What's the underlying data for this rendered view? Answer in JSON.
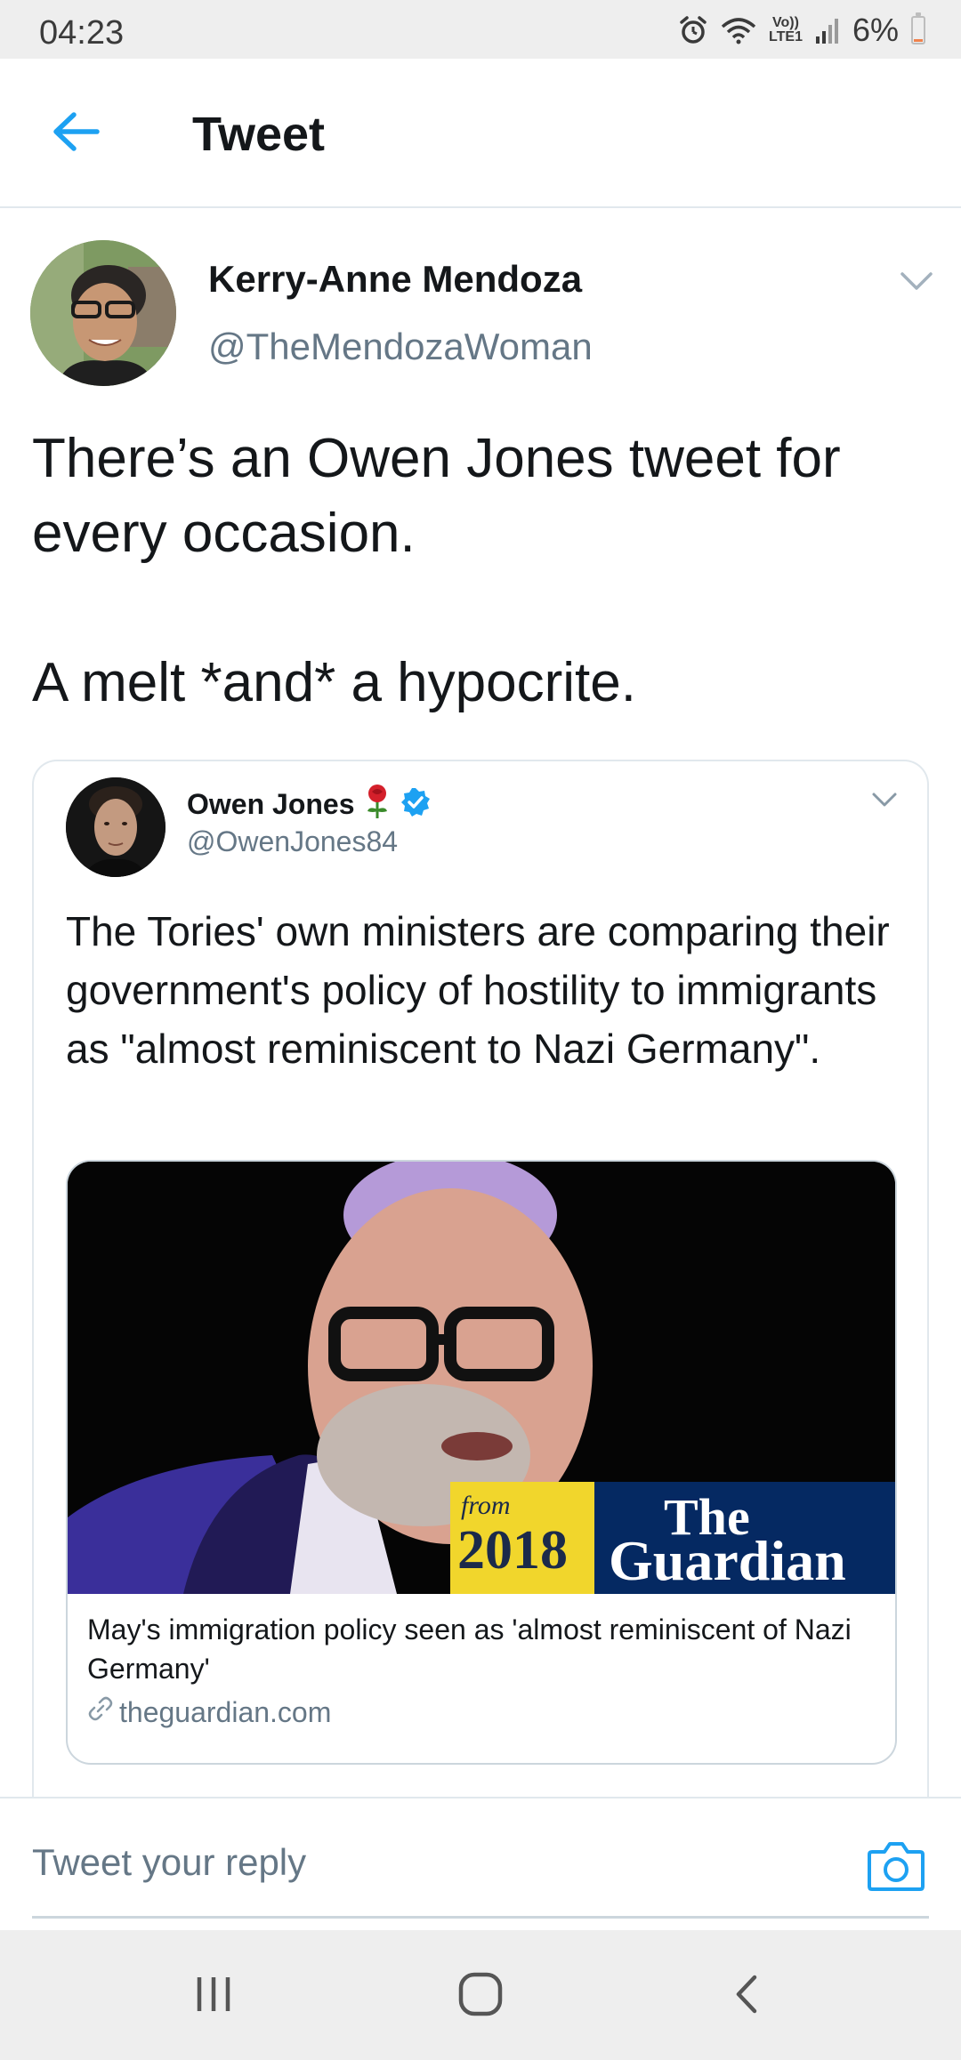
{
  "status_bar": {
    "time": "04:23",
    "icons": [
      "alarm-icon",
      "wifi-icon",
      "volte-lte-icon",
      "signal-icon",
      "battery-icon"
    ],
    "lte_label_top": "Vo))",
    "lte_label_bottom": "LTE1",
    "battery_percent": "6%",
    "battery_level": 0.06
  },
  "header": {
    "back_icon": "arrow-left-icon",
    "title": "Tweet",
    "accent_color": "#1da1f2"
  },
  "tweet": {
    "author_name": "Kerry-Anne Mendoza",
    "author_handle": "@TheMendozaWoman",
    "menu_icon": "chevron-down-icon",
    "text": "There’s an Owen Jones tweet for every occasion.\n\nA melt *and* a hypocrite."
  },
  "quoted_tweet": {
    "author_name": "Owen Jones",
    "rose_icon": "rose-icon",
    "verified_icon": "verified-badge-icon",
    "author_handle": "@OwenJones84",
    "text": "The Tories' own ministers are comparing their government's policy of hostility to immigrants as \"almost reminiscent to Nazi Germany\".",
    "card": {
      "badge_from": "from",
      "badge_year": "2018",
      "brand_line1": "The",
      "brand_line2": "Guardian",
      "title": "May's immigration policy seen as 'almost reminiscent of Nazi Germany'",
      "domain": "theguardian.com",
      "link_icon": "link-icon"
    }
  },
  "reply_bar": {
    "placeholder": "Tweet your reply",
    "camera_icon": "camera-icon"
  },
  "nav_bar": {
    "recents_icon": "recents-icon",
    "home_icon": "home-icon",
    "back_icon": "back-chevron-icon"
  },
  "colors": {
    "text_primary": "#14171a",
    "text_secondary": "#657786",
    "border": "#e1e8ed",
    "guardian_blue": "#052962",
    "guardian_yellow": "#f1d62c"
  }
}
